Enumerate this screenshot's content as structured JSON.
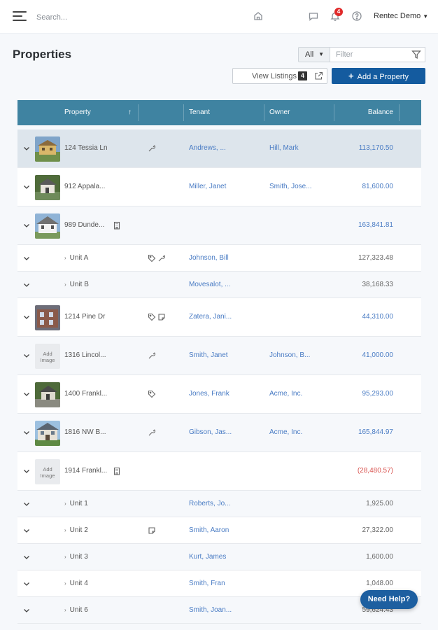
{
  "topbar": {
    "search_placeholder": "Search...",
    "user_name": "Rentec Demo",
    "notification_count": "4"
  },
  "page": {
    "title": "Properties",
    "filter_select_value": "All",
    "filter_placeholder": "Filter",
    "view_listings_label": "View Listings",
    "listings_count": "4",
    "add_property_label": "Add a Property"
  },
  "table": {
    "columns": [
      "Property",
      "Tenant",
      "Owner",
      "Balance"
    ],
    "sort_indicator": "↑",
    "rows": [
      {
        "kind": "property",
        "name": "124 Tessia Ln",
        "tenant": "Andrews, ...",
        "owner": "Hill, Mark",
        "balance": "113,170.50",
        "balance_color": "blue"
      },
      {
        "kind": "property",
        "name": "912 Appala...",
        "tenant": "Miller, Janet",
        "owner": "Smith, Jose...",
        "balance": "81,600.00",
        "balance_color": "blue"
      },
      {
        "kind": "property",
        "name": "989 Dunde...",
        "tenant": "",
        "owner": "",
        "balance": "163,841.81",
        "balance_color": "blue"
      },
      {
        "kind": "unit",
        "name": "Unit A",
        "tenant": "Johnson, Bill",
        "owner": "",
        "balance": "127,323.48",
        "balance_color": "grey"
      },
      {
        "kind": "unit",
        "name": "Unit B",
        "tenant": "Movesalot, ...",
        "owner": "",
        "balance": "38,168.33",
        "balance_color": "grey"
      },
      {
        "kind": "property",
        "name": "1214 Pine Dr",
        "tenant": "Zatera, Jani...",
        "owner": "",
        "balance": "44,310.00",
        "balance_color": "blue"
      },
      {
        "kind": "property",
        "name": "1316 Lincol...",
        "tenant": "Smith, Janet",
        "owner": "Johnson, B...",
        "balance": "41,000.00",
        "balance_color": "blue"
      },
      {
        "kind": "property",
        "name": "1400 Frankl...",
        "tenant": "Jones, Frank",
        "owner": "Acme, Inc.",
        "balance": "95,293.00",
        "balance_color": "blue"
      },
      {
        "kind": "property",
        "name": "1816 NW B...",
        "tenant": "Gibson, Jas...",
        "owner": "Acme, Inc.",
        "balance": "165,844.97",
        "balance_color": "blue"
      },
      {
        "kind": "property",
        "name": "1914 Frankl...",
        "tenant": "",
        "owner": "",
        "balance": "(28,480.57)",
        "balance_color": "red"
      },
      {
        "kind": "unit",
        "name": "Unit 1",
        "tenant": "Roberts, Jo...",
        "owner": "",
        "balance": "1,925.00",
        "balance_color": "grey"
      },
      {
        "kind": "unit",
        "name": "Unit 2",
        "tenant": "Smith, Aaron",
        "owner": "",
        "balance": "27,322.00",
        "balance_color": "grey"
      },
      {
        "kind": "unit",
        "name": "Unit 3",
        "tenant": "Kurt, James",
        "owner": "",
        "balance": "1,600.00",
        "balance_color": "grey"
      },
      {
        "kind": "unit",
        "name": "Unit 4",
        "tenant": "Smith, Fran",
        "owner": "",
        "balance": "1,048.00",
        "balance_color": "grey"
      },
      {
        "kind": "unit",
        "name": "Unit 6",
        "tenant": "Smith, Joan...",
        "owner": "",
        "balance": "59,624.43",
        "balance_color": "grey"
      }
    ],
    "add_image_label": "Add Image"
  },
  "help_button_label": "Need Help?",
  "colors": {
    "header": "#3f83a1",
    "primary_button": "#145b9f",
    "link": "#4a7cc4",
    "negative": "#d9534f",
    "selected_row": "#dde5ec"
  }
}
